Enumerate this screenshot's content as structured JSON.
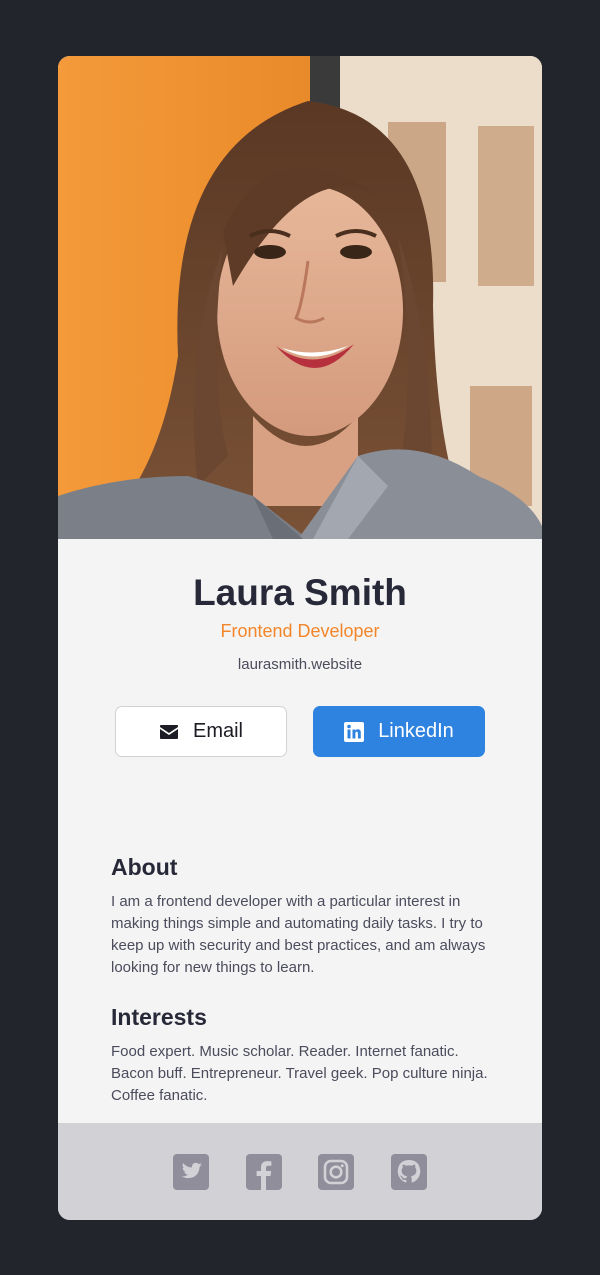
{
  "profile": {
    "name": "Laura Smith",
    "role": "Frontend Developer",
    "website": "laurasmith.website"
  },
  "buttons": {
    "email_label": "Email",
    "linkedin_label": "LinkedIn"
  },
  "about": {
    "title": "About",
    "text": "I am a frontend developer with a particular interest in making things simple and automating daily tasks. I try to keep up with security and best practices, and am always looking for new things to learn."
  },
  "interests": {
    "title": "Interests",
    "text": "Food expert. Music scholar. Reader. Internet fanatic. Bacon buff. Entrepreneur. Travel geek. Pop culture ninja. Coffee fanatic."
  },
  "footer": {
    "social": [
      "twitter-icon",
      "facebook-icon",
      "instagram-icon",
      "github-icon"
    ]
  },
  "colors": {
    "background": "#23252c",
    "card": "#f4f4f4",
    "accent_orange": "#f3862a",
    "linkedin_blue": "#2f83e0",
    "footer": "#d1d1d6",
    "footer_icons": "#918e9b"
  }
}
